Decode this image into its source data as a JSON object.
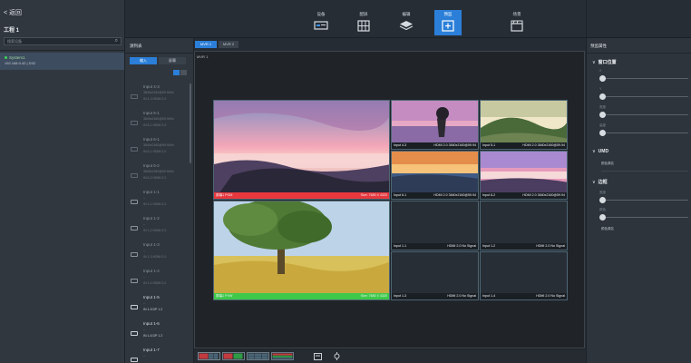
{
  "left": {
    "back_label": "< 返回",
    "project_name": "工程 1",
    "search_placeholder": "搜索设备",
    "device": {
      "name": "System1",
      "address": "192.168.0.42 | D32"
    }
  },
  "toolbar": {
    "items": [
      {
        "label": "设备",
        "icon": "device-icon"
      },
      {
        "label": "配屏",
        "icon": "screen-config-icon"
      },
      {
        "label": "编辑",
        "icon": "layers-icon"
      },
      {
        "label": "预监",
        "icon": "monitor-add-icon",
        "active": true
      },
      {
        "label": "场景",
        "icon": "scene-icon"
      }
    ]
  },
  "sources": {
    "title": "源列表",
    "tab_input": "输入",
    "tab_screen": "屏幕",
    "items": [
      {
        "name": "Input 4-3",
        "res": "3840x2160@59.94Hz",
        "port": "IN 4-3  HDMI 2.0",
        "dim": true
      },
      {
        "name": "Input 5-1",
        "res": "3840x2160@59.94Hz",
        "port": "IN 5-1  HDMI 2.0",
        "dim": true
      },
      {
        "name": "Input 6-1",
        "res": "3840x2160@59.94Hz",
        "port": "IN 6-1  HDMI 2.0",
        "dim": true
      },
      {
        "name": "Input 6-2",
        "res": "3840x2160@59.94Hz",
        "port": "IN 6-2  HDMI 2.0",
        "dim": true
      },
      {
        "name": "Input 1-1",
        "res": "--",
        "port": "IN 1-1  HDMI 2.0",
        "dim": true
      },
      {
        "name": "Input 1-2",
        "res": "--",
        "port": "IN 1-2  HDMI 2.0",
        "dim": true
      },
      {
        "name": "Input 1-3",
        "res": "--",
        "port": "IN 1-3  HDMI 2.0",
        "dim": true
      },
      {
        "name": "Input 1-4",
        "res": "--",
        "port": "IN 1-4  HDMI 2.0",
        "dim": true
      },
      {
        "name": "Input 1-5",
        "res": "--",
        "port": "IN 1-5  DP 1.2",
        "dim": false
      },
      {
        "name": "Input 1-6",
        "res": "--",
        "port": "IN 1-6  DP 1.2",
        "dim": false
      },
      {
        "name": "Input 1-7",
        "res": "--",
        "port": "",
        "dim": false
      }
    ]
  },
  "main": {
    "tabs": [
      "MVR 1",
      "MVR 2"
    ],
    "canvas_title": "MVR 1",
    "pgm": {
      "label": "屏幕1 PGM",
      "size": "Size: 7680 X 4320"
    },
    "pvw": {
      "label": "屏幕1 PVW",
      "size": "Size: 7680 X 4320"
    },
    "tiles": [
      {
        "name": "Input 4-3",
        "info": "HDMI 2.0 3840x2160@59.94"
      },
      {
        "name": "Input 5-1",
        "info": "HDMI 2.0 3840x2160@59.94"
      },
      {
        "name": "Input 6-1",
        "info": "HDMI 2.0 3840x2160@59.94"
      },
      {
        "name": "Input 6-2",
        "info": "HDMI 2.0 3840x2160@59.94"
      },
      {
        "name": "Input 1-1",
        "info": "HDMI 2.0 No Signal"
      },
      {
        "name": "Input 1-2",
        "info": "HDMI 2.0 No Signal"
      },
      {
        "name": "Input 1-3",
        "info": "HDMI 2.0 No Signal"
      },
      {
        "name": "Input 1-4",
        "info": "HDMI 2.0 No Signal"
      }
    ]
  },
  "props": {
    "title": "预监属性",
    "window_section": "窗口位置",
    "labels": [
      "X",
      "Y",
      "宽度",
      "高度"
    ],
    "umd_section": "UMD",
    "umd_item": "颜色源名",
    "border_section": "边框",
    "border_labels": [
      "宽度",
      "颜色"
    ],
    "border_item": "颜色源名"
  },
  "colors": {
    "accent": "#2b7fd8",
    "pgm": "#e8383d",
    "pvw": "#3ec94a"
  }
}
